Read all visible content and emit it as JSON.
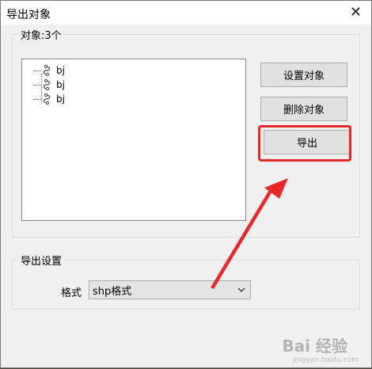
{
  "dialog": {
    "title": "导出对象",
    "close_symbol": "✕"
  },
  "objects_group": {
    "legend": "对象:3个",
    "items": [
      {
        "label": "bj"
      },
      {
        "label": "bj"
      },
      {
        "label": "bj"
      }
    ]
  },
  "buttons": {
    "set_objects": "设置对象",
    "delete_objects": "删除对象",
    "export": "导出"
  },
  "export_settings": {
    "legend": "导出设置",
    "format_label": "格式",
    "format_value": "shp格式"
  },
  "watermark": {
    "text": "Bai 经验",
    "sub": "jingyan.baidu.com"
  },
  "colors": {
    "highlight": "#e8272b",
    "arrow": "#e8272b"
  }
}
